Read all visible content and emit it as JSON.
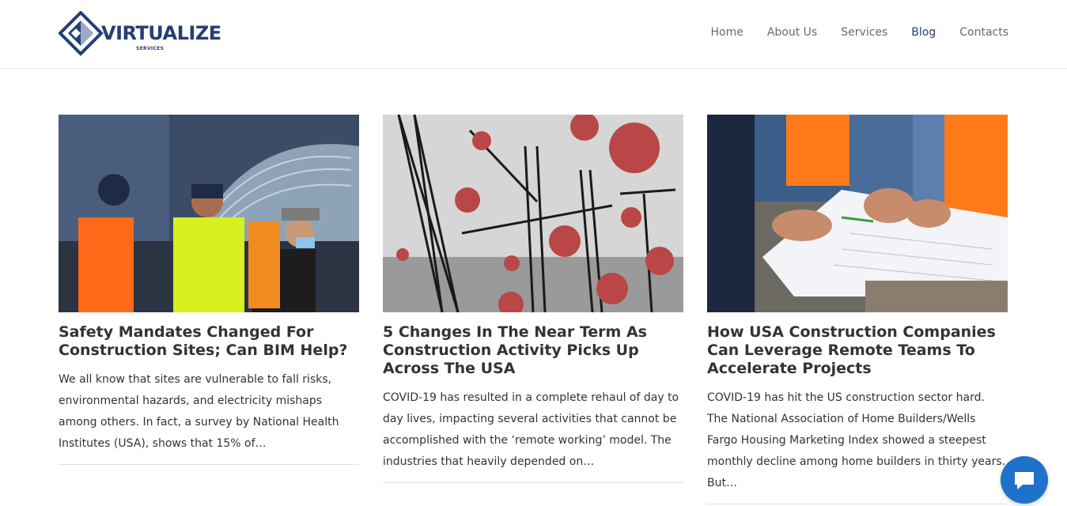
{
  "brand": {
    "name": "VIRTUALIZE",
    "tagline": "SERVICES",
    "color": "#243f73"
  },
  "nav": {
    "items": [
      {
        "label": "Home"
      },
      {
        "label": "About Us"
      },
      {
        "label": "Services"
      },
      {
        "label": "Blog"
      },
      {
        "label": "Contacts"
      }
    ],
    "active": "Blog"
  },
  "posts": [
    {
      "image": "workers-temperature-check-photo",
      "title": "Safety Mandates Changed For Construction Sites; Can BIM Help?",
      "excerpt": "We all know that sites are vulnerable to fall risks, environmental hazards, and electricity mishaps among others. In fact, a survey by National Health Institutes (USA), shows that 15% of…"
    },
    {
      "image": "cranes-and-virus-photo",
      "title": "5 Changes In The Near Term As Construction Activity Picks Up Across The USA",
      "excerpt": "COVID-19 has resulted in a complete rehaul of day to day lives, impacting several activities that cannot be accomplished with the ‘remote working’ model. The industries that heavily depended on…"
    },
    {
      "image": "engineers-reviewing-plans-photo",
      "title": "How USA Construction Companies Can Leverage Remote Teams To Accelerate Projects",
      "excerpt": "COVID-19 has hit the US construction sector hard. The National Association of Home Builders/Wells Fargo Housing Marketing Index showed a steepest monthly decline among home builders in thirty years. But…"
    }
  ],
  "chat": {
    "icon": "chat-bubble-icon",
    "color": "#1f72c9"
  }
}
